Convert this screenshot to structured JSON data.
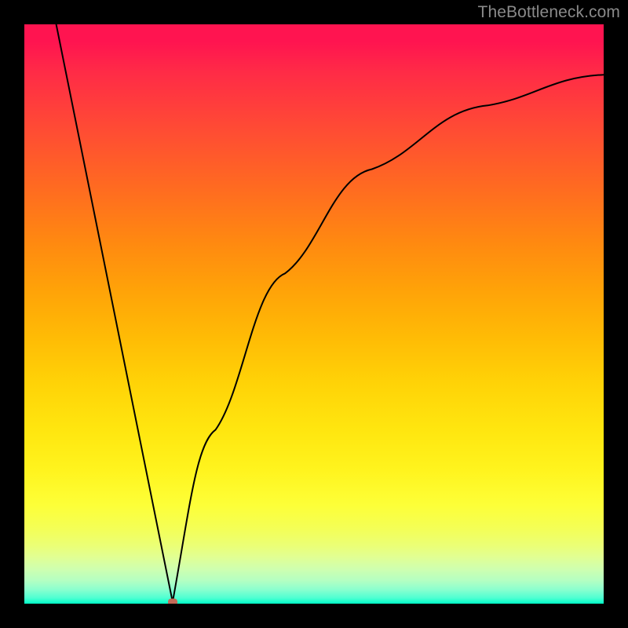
{
  "watermark": "TheBottleneck.com",
  "chart_data": {
    "type": "line",
    "title": "",
    "xlabel": "",
    "ylabel": "",
    "x_range": [
      0,
      100
    ],
    "y_range": [
      0,
      100
    ],
    "grid": false,
    "legend": false,
    "series": [
      {
        "name": "bottleneck-curve",
        "color": "#000000",
        "points": [
          {
            "x": 5.5,
            "y": 100
          },
          {
            "x": 25.6,
            "y": 0.3
          },
          {
            "x": 33,
            "y": 30
          },
          {
            "x": 45,
            "y": 57
          },
          {
            "x": 60,
            "y": 75
          },
          {
            "x": 80,
            "y": 86
          },
          {
            "x": 100,
            "y": 91.3
          }
        ]
      }
    ],
    "markers": [
      {
        "name": "minimum-point",
        "x": 25.6,
        "y": 0.3,
        "color": "#c36a58"
      }
    ],
    "background_gradient": {
      "top": "#ff1450",
      "middle": "#ffd000",
      "bottom": "#00ffc8"
    }
  }
}
